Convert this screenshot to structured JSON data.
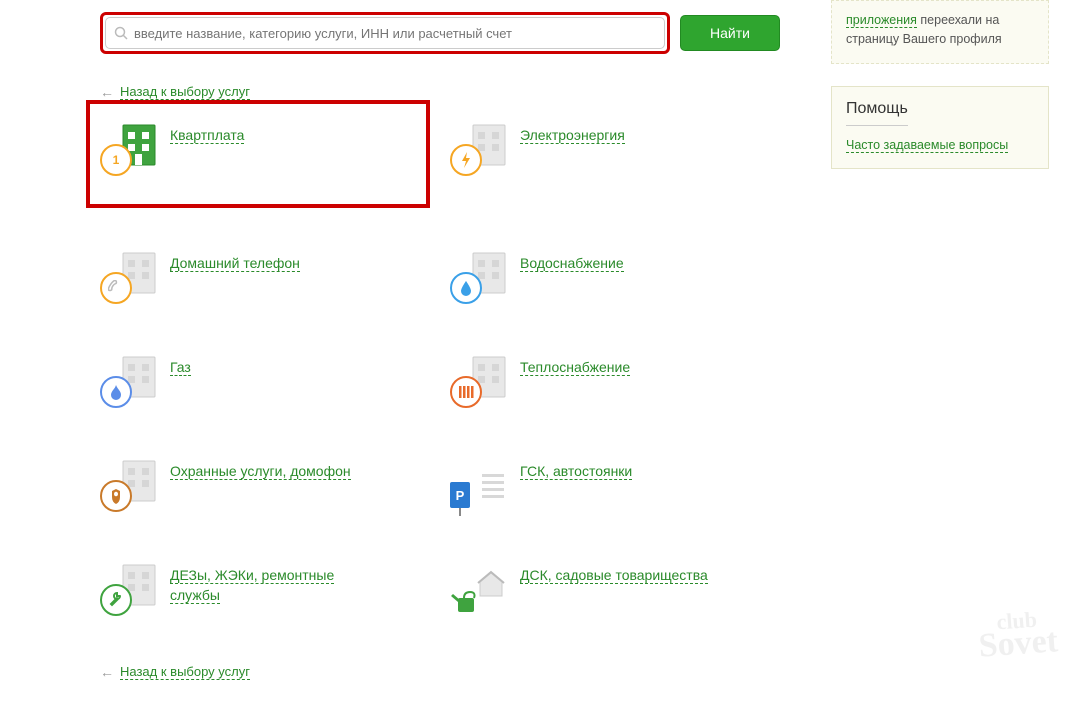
{
  "search": {
    "placeholder": "введите название, категорию услуги, ИНН или расчетный счет",
    "button": "Найти"
  },
  "back_link": "Назад к выбору услуг",
  "services": {
    "kvartplata": "Квартплата",
    "electro": "Электроэнергия",
    "phone": "Домашний телефон",
    "water": "Водоснабжение",
    "gas": "Газ",
    "heat": "Теплоснабжение",
    "security": "Охранные услуги, домофон",
    "parking": "ГСК, автостоянки",
    "dez": "ДЕЗы, ЖЭКи, ремонтные службы",
    "dsk": "ДСК, садовые товарищества"
  },
  "badge_number": "1",
  "sidebar": {
    "notice_link": "приложения",
    "notice_rest": " переехали на страницу Вашего профиля",
    "help_title": "Помощь",
    "help_link": "Часто задаваемые вопросы"
  },
  "watermark": {
    "l1": "club",
    "l2": "Sovet"
  }
}
